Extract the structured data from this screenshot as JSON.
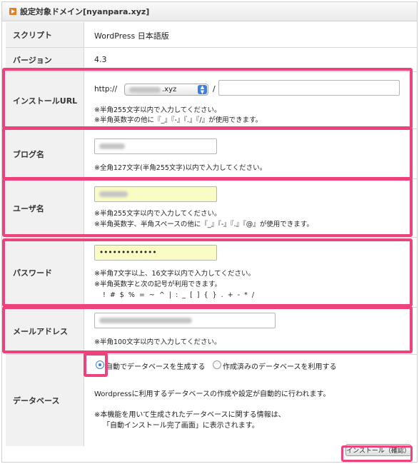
{
  "header": {
    "title": "設定対象ドメイン[nyanpara.xyz]"
  },
  "rows": {
    "script": {
      "label": "スクリプト",
      "value": "WordPress 日本語版"
    },
    "version": {
      "label": "バージョン",
      "value": "4.3"
    },
    "install_url": {
      "label": "インストールURL",
      "protocol": "http://",
      "domain_select": ".xyz",
      "slash": "/",
      "path_value": "",
      "notes": [
        "※半角255文字以内で入力してください。",
        "※半角英数字の他に『_』『-』『.』『/』が使用できます。"
      ]
    },
    "blog_name": {
      "label": "ブログ名",
      "notes": [
        "※全角127文字(半角255文字)以内で入力してください。"
      ]
    },
    "user_name": {
      "label": "ユーザ名",
      "notes": [
        "※半角255文字以内で入力してください。",
        "※半角英数字、半角スペースの他に『_』『-』『.』『@』が使用できます。"
      ]
    },
    "password": {
      "label": "パスワード",
      "value": "•••••••••••••",
      "notes": [
        "※半角7文字以上、16文字以内で入力してください。",
        "※半角英数字と次の記号が利用できます。",
        "! # $ % = ~ ^ | : _ [ ] { } . + - * /"
      ]
    },
    "email": {
      "label": "メールアドレス",
      "notes": [
        "※半角100文字以内で入力してください。"
      ]
    },
    "database": {
      "label": "データベース",
      "option_auto": "自動でデータベースを生成する",
      "option_existing": "作成済みのデータベースを利用する",
      "desc1": "Wordpressに利用するデータベースの作成や設定が自動的に行われます。",
      "desc2": "※本機能を用いて生成されたデータベースに関する情報は、",
      "desc3": "「自動インストール完了画面」に表示されます。"
    }
  },
  "actions": {
    "submit_label": "インストール（確認）"
  },
  "colors": {
    "highlight": "#f0427a",
    "field_autofill": "#fbfbc5",
    "label_bg": "#f1f1f1",
    "radio_accent": "#3b7fe0"
  }
}
